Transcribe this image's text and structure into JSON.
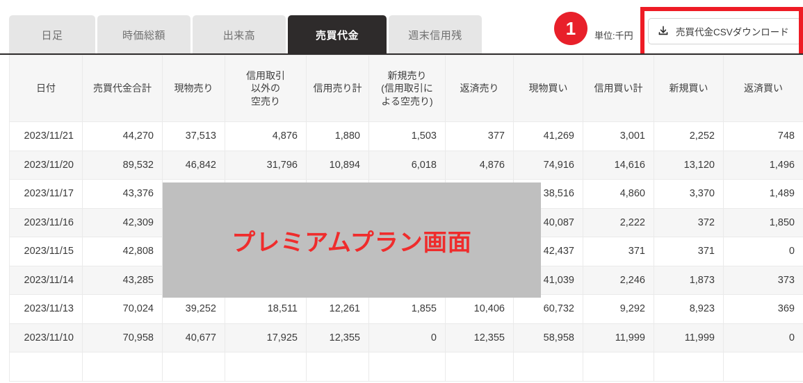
{
  "tabs": [
    {
      "label": "日足",
      "active": false
    },
    {
      "label": "時価総額",
      "active": false
    },
    {
      "label": "出来高",
      "active": false
    },
    {
      "label": "売買代金",
      "active": true
    },
    {
      "label": "週末信用残",
      "active": false
    }
  ],
  "annotation": {
    "badge_number": "1",
    "badge_color": "#e8202a",
    "box_color": "#ee1c25"
  },
  "toolbar": {
    "unit_label": "単位:千円",
    "csv_button_label": "売買代金CSVダウンロード",
    "csv_button_icon": "download-icon"
  },
  "overlay": {
    "text": "プレミアムプラン画面",
    "text_color": "#ef2c2c",
    "fill_color": "#bfbfbf"
  },
  "table": {
    "columns": [
      "日付",
      "売買代金合計",
      "現物売り",
      "信用取引\n以外の\n空売り",
      "信用売り計",
      "新規売り\n(信用取引に\nよる空売り)",
      "返済売り",
      "現物買い",
      "信用買い計",
      "新規買い",
      "返済買い"
    ],
    "rows": [
      [
        "2023/11/21",
        "44,270",
        "37,513",
        "4,876",
        "1,880",
        "1,503",
        "377",
        "41,269",
        "3,001",
        "2,252",
        "748"
      ],
      [
        "2023/11/20",
        "89,532",
        "46,842",
        "31,796",
        "10,894",
        "6,018",
        "4,876",
        "74,916",
        "14,616",
        "13,120",
        "1,496"
      ],
      [
        "2023/11/17",
        "43,376",
        "",
        "",
        "",
        "",
        "",
        "38,516",
        "4,860",
        "3,370",
        "1,489"
      ],
      [
        "2023/11/16",
        "42,309",
        "",
        "",
        "",
        "",
        "",
        "40,087",
        "2,222",
        "372",
        "1,850"
      ],
      [
        "2023/11/15",
        "42,808",
        "",
        "",
        "",
        "",
        "",
        "42,437",
        "371",
        "371",
        "0"
      ],
      [
        "2023/11/14",
        "43,285",
        "",
        "",
        "",
        "",
        "",
        "41,039",
        "2,246",
        "1,873",
        "373"
      ],
      [
        "2023/11/13",
        "70,024",
        "39,252",
        "18,511",
        "12,261",
        "1,855",
        "10,406",
        "60,732",
        "9,292",
        "8,923",
        "369"
      ],
      [
        "2023/11/10",
        "70,958",
        "40,677",
        "17,925",
        "12,355",
        "0",
        "12,355",
        "58,958",
        "11,999",
        "11,999",
        "0"
      ],
      [
        "",
        "",
        "",
        "",
        "",
        "",
        "",
        "",
        "",
        "",
        ""
      ]
    ]
  }
}
